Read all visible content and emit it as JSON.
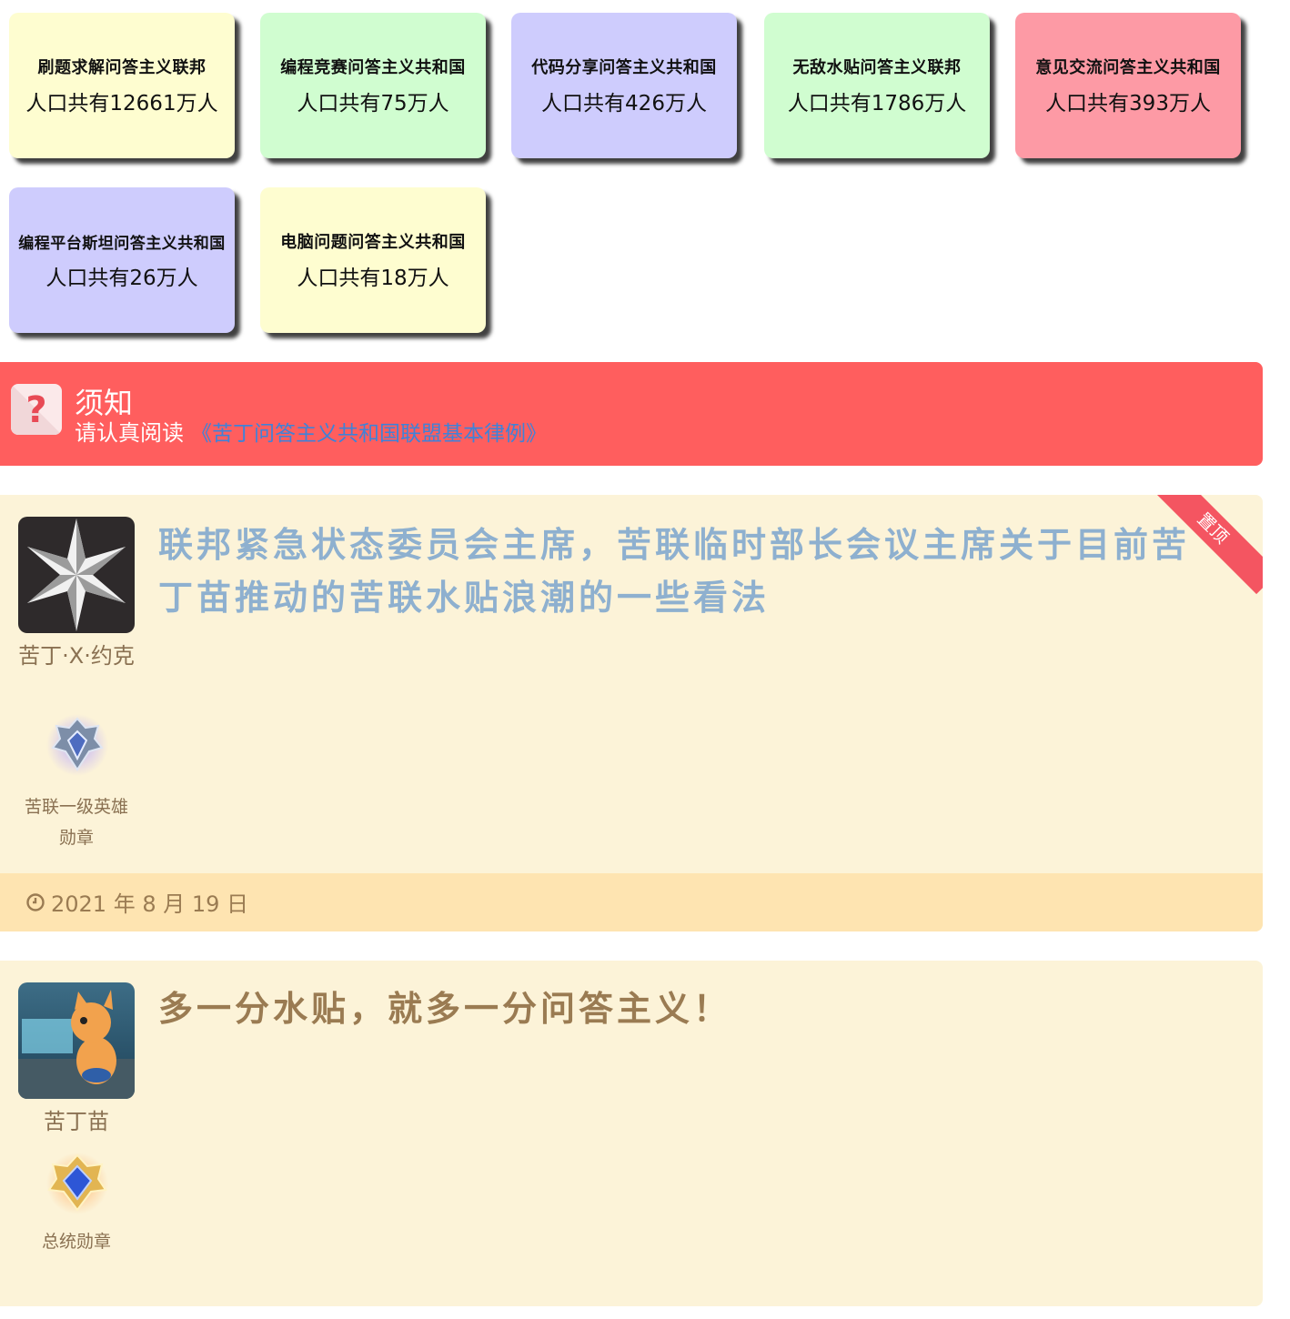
{
  "federations": [
    {
      "name": "刷题求解问答主义联邦",
      "population": "人口共有12661万人",
      "color": "#fefdd0"
    },
    {
      "name": "编程竞赛问答主义共和国",
      "population": "人口共有75万人",
      "color": "#d0fdd0"
    },
    {
      "name": "代码分享问答主义共和国",
      "population": "人口共有426万人",
      "color": "#ceccfd"
    },
    {
      "name": "无敌水贴问答主义联邦",
      "population": "人口共有1786万人",
      "color": "#d0fdd0"
    },
    {
      "name": "意见交流问答主义共和国",
      "population": "人口共有393万人",
      "color": "#fd9aa5"
    },
    {
      "name": "编程平台斯坦问答主义共和国",
      "population": "人口共有26万人",
      "color": "#ceccfd"
    },
    {
      "name": "电脑问题问答主义共和国",
      "population": "人口共有18万人",
      "color": "#fefdd0"
    }
  ],
  "notice": {
    "icon": "question-icon",
    "title": "须知",
    "text": "请认真阅读",
    "link": "《苦丁问答主义共和国联盟基本律例》"
  },
  "posts": [
    {
      "author": "苦丁·X·约克",
      "badge": "苦联一级英雄勋章",
      "title": "联邦紧急状态委员会主席，苦联临时部长会议主席关于目前苦丁苗推动的苦联水贴浪潮的一些看法",
      "ribbon": "置顶",
      "date": "2021 年 8 月 19 日"
    },
    {
      "author": "苦丁苗",
      "badge": "总统勋章",
      "title": "多一分水贴，就多一分问答主义！"
    }
  ]
}
